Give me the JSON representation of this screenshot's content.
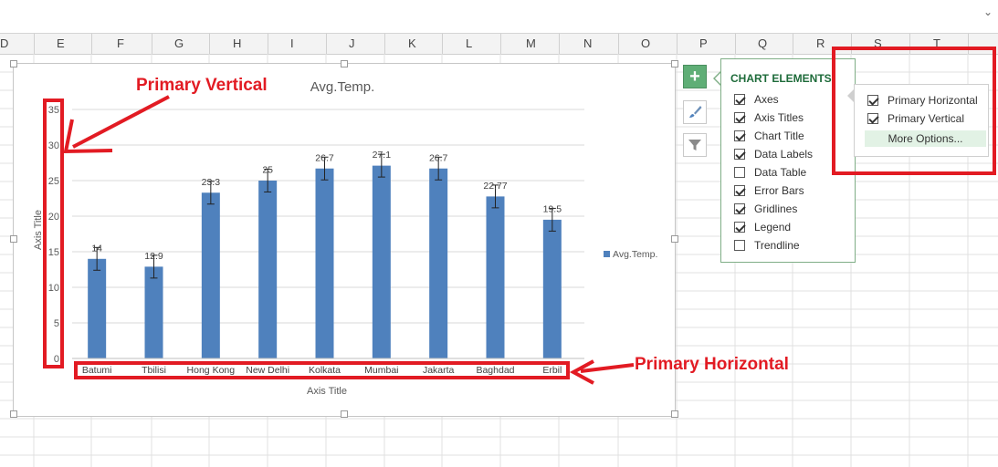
{
  "spreadsheet": {
    "columns": [
      "D",
      "E",
      "F",
      "G",
      "H",
      "I",
      "J",
      "K",
      "L",
      "M",
      "N",
      "O",
      "P",
      "Q",
      "R",
      "S",
      "T"
    ]
  },
  "chart_data": {
    "type": "bar",
    "title": "Avg.Temp.",
    "categories": [
      "Batumi",
      "Tbilisi",
      "Hong Kong",
      "New Delhi",
      "Kolkata",
      "Mumbai",
      "Jakarta",
      "Baghdad",
      "Erbil"
    ],
    "series": [
      {
        "name": "Avg.Temp.",
        "values": [
          14,
          12.9,
          23.3,
          25,
          26.7,
          27.1,
          26.7,
          22.77,
          19.5
        ],
        "color": "#4f81bd"
      }
    ],
    "data_labels": [
      "14",
      "12.9",
      "23.3",
      "25",
      "26.7",
      "27.1",
      "26.7",
      "22.77",
      "19.5"
    ],
    "error_bars": true,
    "xlabel": "Axis Title",
    "ylabel": "Axis Title",
    "ylim": [
      0,
      35
    ],
    "yticks": [
      "0",
      "5",
      "10",
      "15",
      "20",
      "25",
      "30",
      "35"
    ],
    "grid": true,
    "legend": "right"
  },
  "chart_elements_panel": {
    "title": "CHART ELEMENTS",
    "items": [
      {
        "label": "Axes",
        "checked": true
      },
      {
        "label": "Axis Titles",
        "checked": true
      },
      {
        "label": "Chart Title",
        "checked": true
      },
      {
        "label": "Data Labels",
        "checked": true
      },
      {
        "label": "Data Table",
        "checked": false
      },
      {
        "label": "Error Bars",
        "checked": true
      },
      {
        "label": "Gridlines",
        "checked": true
      },
      {
        "label": "Legend",
        "checked": true
      },
      {
        "label": "Trendline",
        "checked": false
      }
    ]
  },
  "axes_submenu": {
    "items": [
      {
        "label": "Primary Horizontal",
        "checked": true
      },
      {
        "label": "Primary Vertical",
        "checked": true
      }
    ],
    "more_options": "More Options..."
  },
  "side_buttons": {
    "plus_icon": "plus-icon",
    "brush_icon": "brush-icon",
    "filter_icon": "filter-icon"
  },
  "annotations": {
    "vertical_label": "Primary Vertical",
    "horizontal_label": "Primary Horizontal",
    "color": "#e21b23"
  }
}
